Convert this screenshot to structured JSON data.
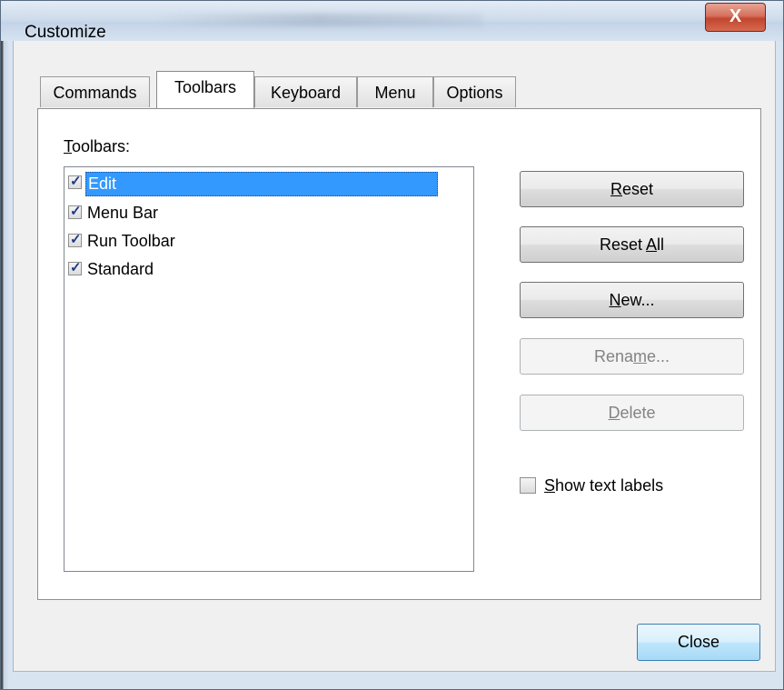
{
  "window": {
    "title": "Customize",
    "close_glyph": "X"
  },
  "tabs": [
    {
      "label": "Commands",
      "active": false
    },
    {
      "label": "Toolbars",
      "active": true
    },
    {
      "label": "Keyboard",
      "active": false
    },
    {
      "label": "Menu",
      "active": false
    },
    {
      "label": "Options",
      "active": false
    }
  ],
  "toolbars_panel": {
    "list_label_accel": "T",
    "list_label_rest": "oolbars:",
    "items": [
      {
        "label": "Edit",
        "checked": true,
        "selected": true
      },
      {
        "label": "Menu Bar",
        "checked": true,
        "selected": false
      },
      {
        "label": "Run Toolbar",
        "checked": true,
        "selected": false
      },
      {
        "label": "Standard",
        "checked": true,
        "selected": false
      }
    ],
    "check_glyph": "✓"
  },
  "buttons": {
    "reset": {
      "accel": "R",
      "rest": "eset",
      "enabled": true
    },
    "reset_all": {
      "pre": "Reset ",
      "accel": "A",
      "rest": "ll",
      "enabled": true
    },
    "new": {
      "accel": "N",
      "rest": "ew...",
      "enabled": true
    },
    "rename": {
      "pre": "Rena",
      "accel": "m",
      "rest": "e...",
      "enabled": false
    },
    "delete": {
      "accel": "D",
      "rest": "elete",
      "enabled": false
    }
  },
  "show_text_labels": {
    "accel": "S",
    "rest": "how text labels",
    "checked": false
  },
  "close_button": {
    "label": "Close"
  },
  "colors": {
    "selection": "#3399ff",
    "close_red": "#c2452f",
    "default_button_border": "#3c7fb1"
  }
}
